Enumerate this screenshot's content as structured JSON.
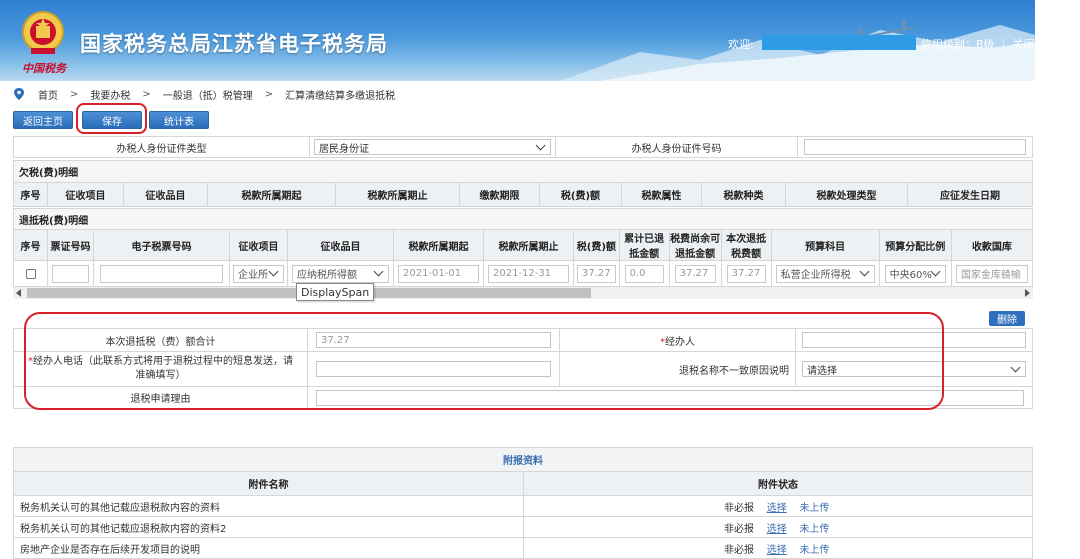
{
  "header": {
    "title": "国家税务总局江苏省电子税务局",
    "brand_script": "中国税务",
    "welcome": "欢迎:",
    "credit": "信用级别：B级 ｜ 关闭"
  },
  "breadcrumb": {
    "items": [
      "首页",
      "我要办税",
      "一般退（抵）税管理",
      "汇算清缴结算多缴退抵税"
    ],
    "separator": ">"
  },
  "toolbar": {
    "home": "返回主页",
    "save": "保存",
    "stats": "统计表"
  },
  "applicant": {
    "id_type_label": "办税人身份证件类型",
    "id_type_value": "居民身份证",
    "id_no_label": "办税人身份证件号码",
    "id_no_value": ""
  },
  "owed_section": {
    "title": "欠税(费)明细",
    "columns": [
      "序号",
      "征收项目",
      "征收品目",
      "税款所属期起",
      "税款所属期止",
      "缴款期限",
      "税(费)额",
      "税款属性",
      "税款种类",
      "税款处理类型",
      "应征发生日期"
    ]
  },
  "refund_section": {
    "title": "退抵税(费)明细",
    "columns": [
      "序号",
      "票证号码",
      "电子税票号码",
      "征收项目",
      "征收品目",
      "税款所属期起",
      "税款所属期止",
      "税(费)额",
      "累计已退抵金额",
      "税费尚余可退抵金额",
      "本次退抵税费额",
      "预算科目",
      "预算分配比例",
      "收款国库"
    ],
    "row": {
      "ticket_no": "",
      "e_ticket_no": "",
      "levy_item": "企业所",
      "levy_subitem": "应纳税所得额",
      "period_start": "2021-01-01",
      "period_end": "2021-12-31",
      "amount": "37.27",
      "refunded": "0.0",
      "remaining": "37.27",
      "this_refund": "37.27",
      "budget_subject": "私营企业所得税",
      "budget_ratio": "中央60%",
      "treasury": "国家金库赣榆"
    },
    "tooltip": "DisplaySpan",
    "delete": "删除"
  },
  "summary": {
    "total_label": "本次退抵税（费）额合计",
    "total_value": "37.27",
    "handler_label": "经办人",
    "handler_value": "",
    "phone_label": "经办人电话（此联系方式将用于退税过程中的短息发送，请准确填写）",
    "phone_value": "",
    "name_mismatch_label": "退税名称不一致原因说明",
    "name_mismatch_value": "请选择",
    "reason_label": "退税申请理由",
    "reason_value": "",
    "required_mark": "*"
  },
  "attachments": {
    "title": "附报资料",
    "col_name": "附件名称",
    "col_status": "附件状态",
    "rows": [
      {
        "name": "税务机关认可的其他记载应退税款内容的资料",
        "required": "非必报",
        "select": "选择",
        "state": "未上传"
      },
      {
        "name": "税务机关认可的其他记载应退税款内容的资料2",
        "required": "非必报",
        "select": "选择",
        "state": "未上传"
      },
      {
        "name": "房地产企业是否存在后续开发项目的说明",
        "required": "非必报",
        "select": "选择",
        "state": "未上传"
      }
    ]
  },
  "colors": {
    "accent": "#2b6cb8",
    "annotation": "#d8202a"
  }
}
